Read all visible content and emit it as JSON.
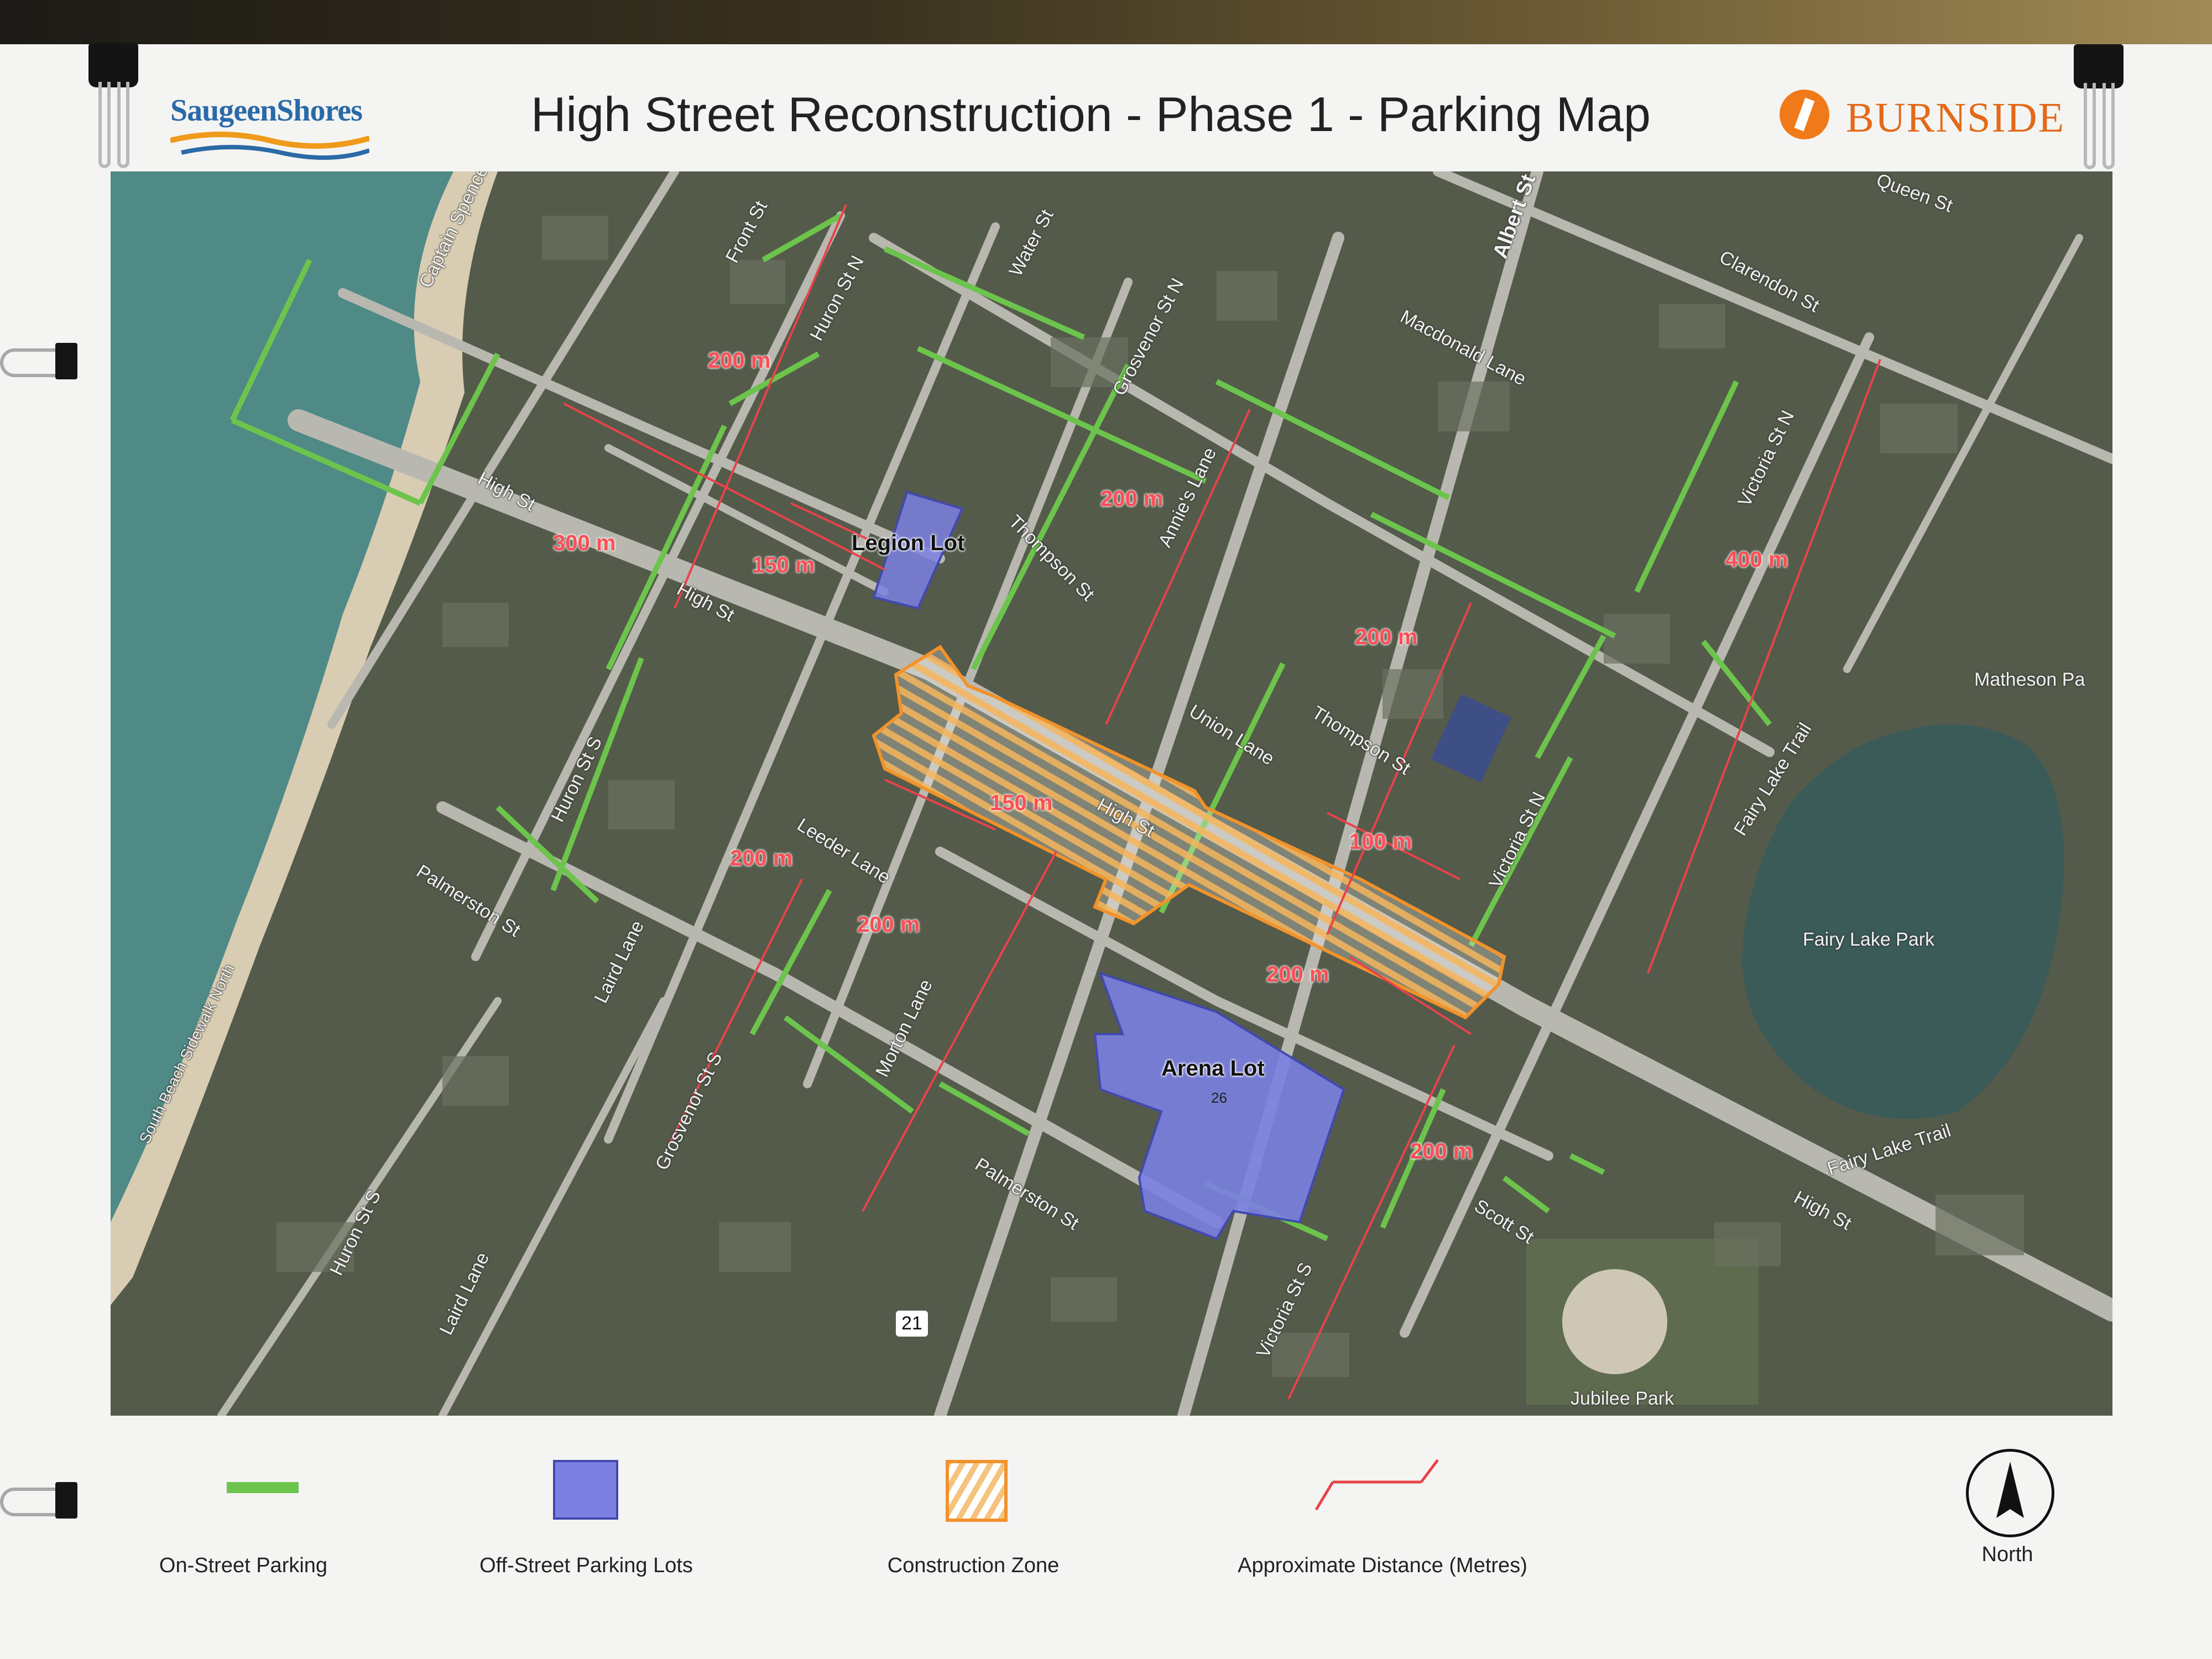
{
  "header": {
    "title": "High Street Reconstruction - Phase 1 - Parking Map",
    "logo_left": {
      "part1": "Saugeen",
      "part2": "Shores"
    },
    "logo_right": {
      "brand": "BURNSIDE"
    }
  },
  "map": {
    "streets": {
      "front": "Front St",
      "huron_n": "Huron St N",
      "water": "Water St",
      "grosvenor_n": "Grosvenor St N",
      "albert": "Albert St",
      "queen": "Queen St",
      "clarendon": "Clarendon St",
      "macdonald": "Macdonald Lane",
      "victoria_n": "Victoria St N",
      "captain": "Captain Spence",
      "high_1": "High St",
      "high_2": "High St",
      "high_3": "High St",
      "high_4": "High St",
      "thompson_1": "Thompson St",
      "thompson_2": "Thompson St",
      "annies": "Annie's Lane",
      "union": "Union Lane",
      "huron_s_1": "Huron St S",
      "huron_s_2": "Huron St S",
      "palmerston_1": "Palmerston St",
      "palmerston_2": "Palmerston St",
      "leeder": "Leeder Lane",
      "laird_1": "Laird Lane",
      "laird_2": "Laird Lane",
      "grosvenor_s": "Grosvenor St S",
      "morton": "Morton Lane",
      "victoria_s_1": "Victoria St N",
      "victoria_s_2": "Victoria St S",
      "scott": "Scott St",
      "south_beach": "South Beach Sidewalk North",
      "fairy_trail_1": "Fairy Lake Trail",
      "fairy_trail_2": "Fairy Lake Trail",
      "matheson": "Matheson Pa",
      "fairy_lake_park": "Fairy Lake Park",
      "jubilee_park": "Jubilee Park",
      "route_21": "21"
    },
    "lots": {
      "legion": "Legion Lot",
      "arena": "Arena Lot",
      "arena_number": "26"
    },
    "distances": {
      "d1": "200 m",
      "d2": "300 m",
      "d3": "150 m",
      "d4": "200 m",
      "d5": "200 m",
      "d6": "400 m",
      "d7": "150 m",
      "d8": "100 m",
      "d9": "200 m",
      "d10": "200 m",
      "d11": "200 m",
      "d12": "200 m"
    }
  },
  "legend": {
    "on_street": "On-Street Parking",
    "off_street": "Off-Street Parking Lots",
    "construction": "Construction Zone",
    "distance": "Approximate Distance (Metres)",
    "north": "North"
  },
  "colors": {
    "on_street": "#6cc44c",
    "off_street_fill": "#7b80e2",
    "construction": "#f1922a",
    "distance": "#e8434b"
  }
}
